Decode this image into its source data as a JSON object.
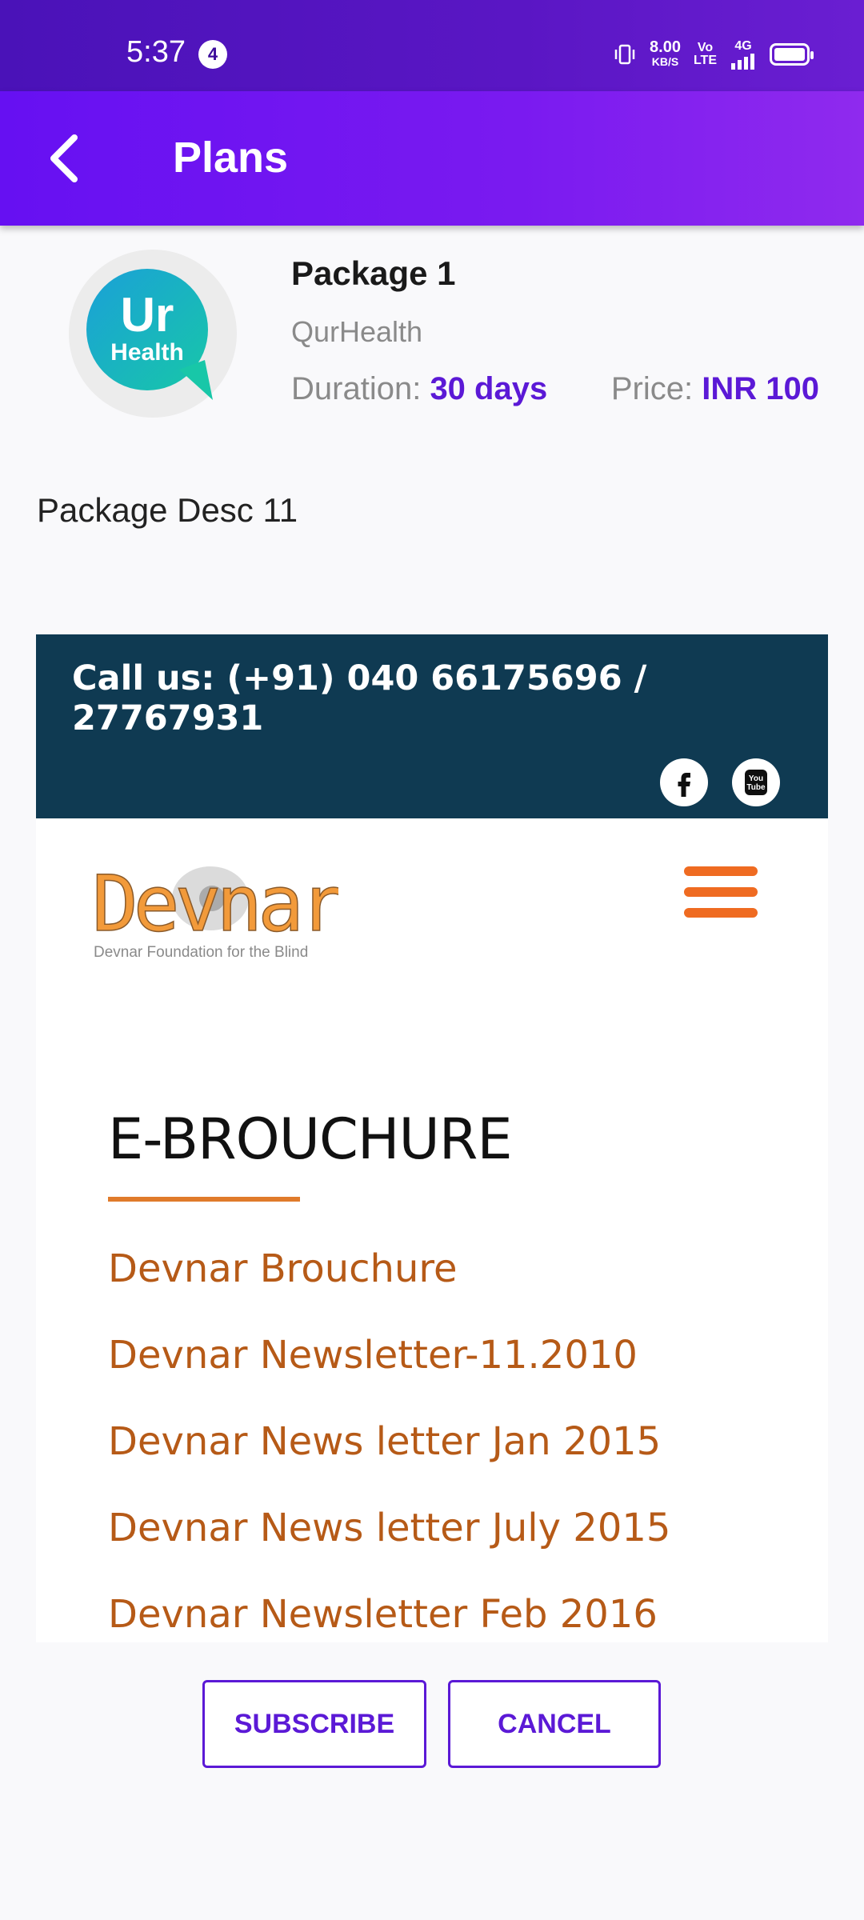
{
  "status_bar": {
    "time": "5:37",
    "notification_count": "4",
    "net_speed": "8.00",
    "net_speed_unit": "KB/S",
    "volte_top": "Vo",
    "volte_bottom": "LTE",
    "signal": "4G"
  },
  "app_bar": {
    "title": "Plans",
    "back_icon": "chevron-left-icon"
  },
  "package": {
    "name": "Package 1",
    "provider": "QurHealth",
    "logo_text_top": "Ur",
    "logo_text_bottom": "Health",
    "duration_label": "Duration:",
    "duration_value": "30 days",
    "price_label": "Price:",
    "price_value": "INR 100",
    "description": "Package Desc 11"
  },
  "webpage": {
    "call_us": "Call us: (+91) 040 66175696 / 27767931",
    "social_icons": [
      "facebook-icon",
      "youtube-icon"
    ],
    "youtube_text_top": "You",
    "youtube_text_bottom": "Tube",
    "logo_text": "Devnar",
    "logo_tagline": "Devnar Foundation for the Blind",
    "section_title": "E-BROUCHURE",
    "links": [
      "Devnar Brouchure",
      "Devnar Newsletter-11.2010",
      "Devnar News letter Jan 2015",
      "Devnar News letter July 2015",
      "Devnar Newsletter Feb 2016"
    ],
    "colors": {
      "topbar": "#0f3a52",
      "accent": "#ef6b21",
      "link": "#b65a17"
    }
  },
  "actions": {
    "subscribe": "SUBSCRIBE",
    "cancel": "CANCEL"
  },
  "colors": {
    "primary": "#6610f2",
    "accent_text": "#5b19d6"
  }
}
